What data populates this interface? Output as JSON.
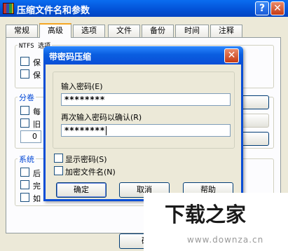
{
  "main_window": {
    "title": "压缩文件名和参数",
    "help_glyph": "?",
    "close_glyph": "✕",
    "tabs": [
      "常规",
      "高级",
      "选项",
      "文件",
      "备份",
      "时间",
      "注释"
    ],
    "active_tab": "高级",
    "groups": {
      "ntfs": {
        "label": "NTFS 选项",
        "items": [
          "保",
          "保"
        ]
      },
      "volume": {
        "label": "分卷",
        "items": [
          "每",
          "旧"
        ],
        "number_value": "0"
      },
      "system": {
        "label": "系统",
        "items": [
          "后",
          "完",
          "如"
        ]
      }
    },
    "bottom_button_label": "确"
  },
  "dialog": {
    "title": "带密码压缩",
    "close_glyph": "✕",
    "enter_password_label": "输入密码(E)",
    "enter_password_value": "********",
    "reenter_password_label": "再次输入密码以确认(R)",
    "reenter_password_value": "********",
    "show_password_label": "显示密码(S)",
    "encrypt_filenames_label": "加密文件名(N)",
    "ok_label": "确定",
    "cancel_label": "取消",
    "help_label": "帮助"
  },
  "watermark": {
    "logo_text": "下载之家",
    "url": "www.downza.cn"
  }
}
